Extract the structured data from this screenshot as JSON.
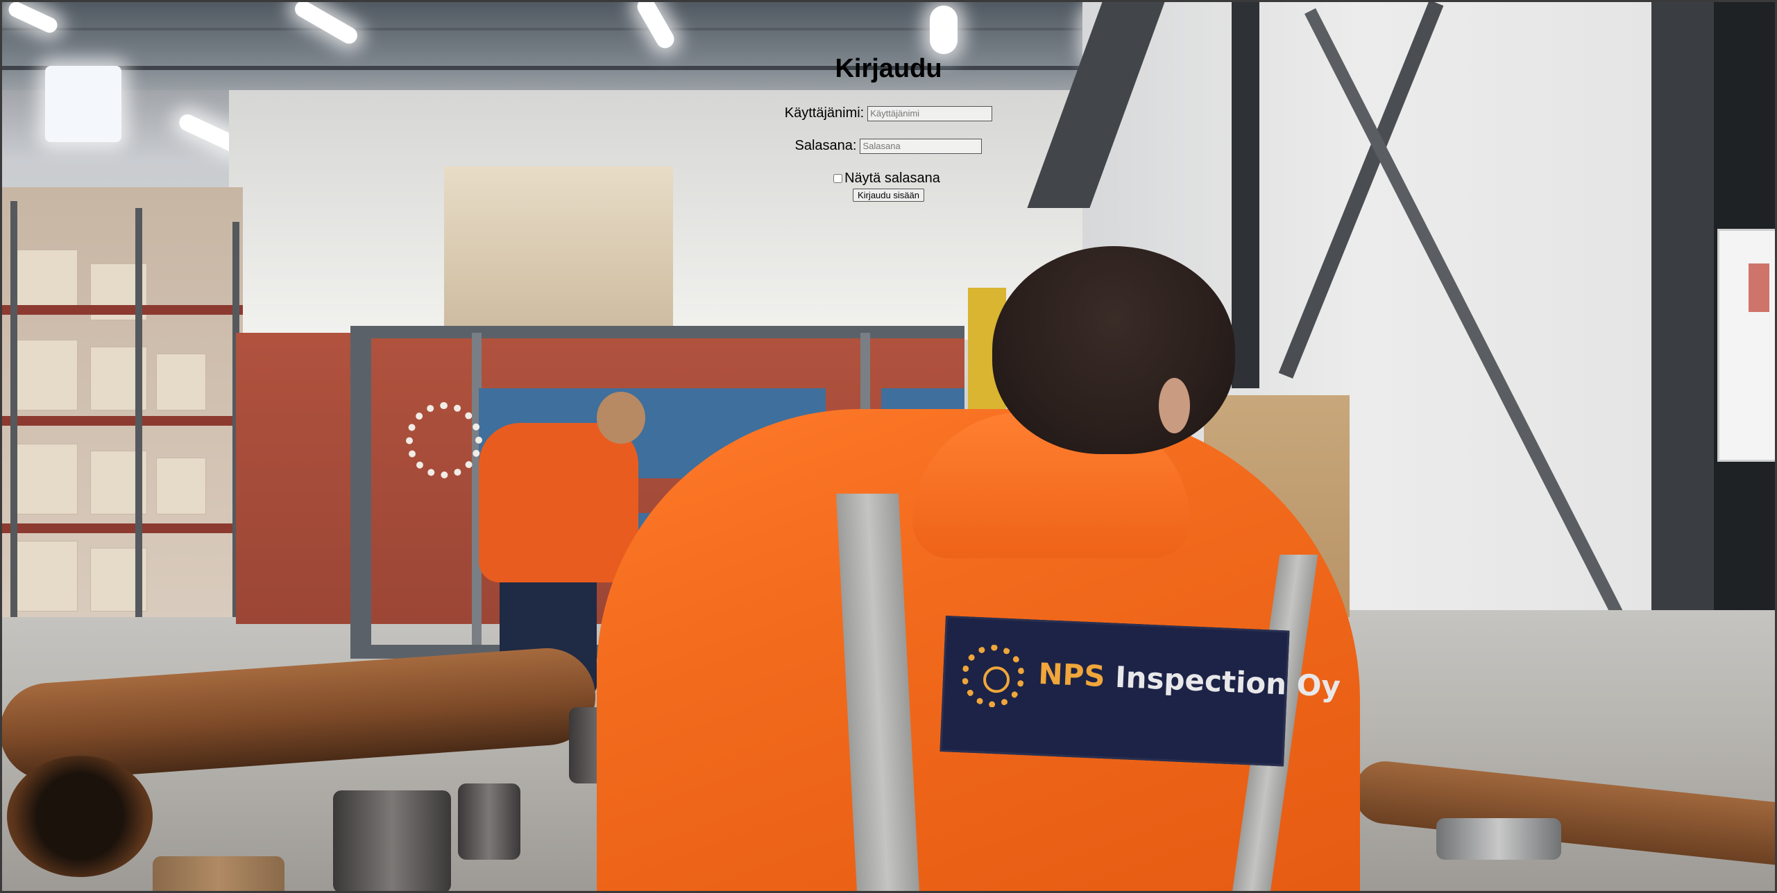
{
  "login": {
    "title": "Kirjaudu",
    "username_label": "Käyttäjänimi:",
    "username_placeholder": "Käyttäjänimi",
    "username_value": "",
    "password_label": "Salasana:",
    "password_placeholder": "Salasana",
    "password_value": "",
    "show_password_label": "Näytä salasana",
    "show_password_checked": false,
    "submit_label": "Kirjaudu sisään"
  },
  "background": {
    "patch_brand": "NPS",
    "patch_text": "Inspection Oy",
    "patch_color_brand": "#f0a63a",
    "patch_color_bg": "#1c2346",
    "jacket_color": "#f26a1c"
  }
}
